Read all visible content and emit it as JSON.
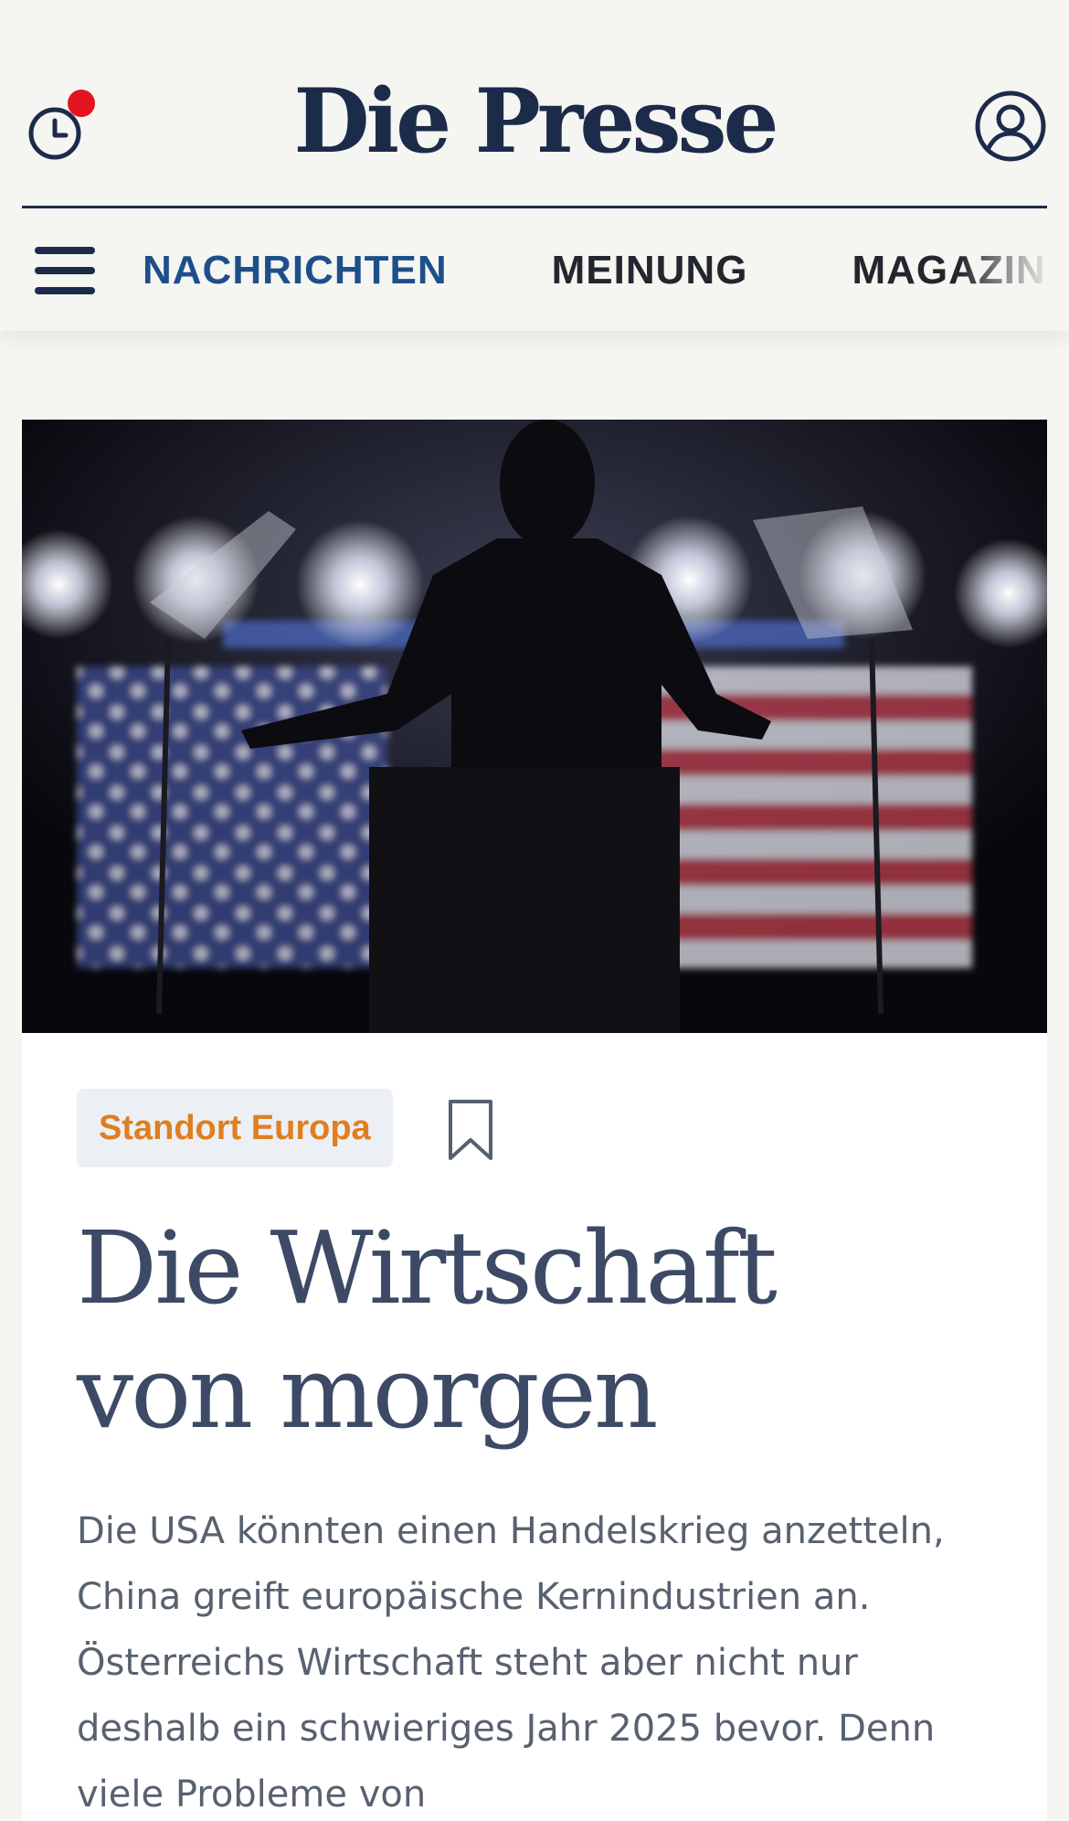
{
  "header": {
    "logo": "Die Presse",
    "has_notification": true
  },
  "nav": {
    "items": [
      {
        "label": "NACHRICHTEN",
        "active": true
      },
      {
        "label": "MEINUNG",
        "active": false
      },
      {
        "label": "MAGAZIN",
        "active": false
      }
    ]
  },
  "article": {
    "image_alt": "Silhouette eines Redners vor US-Flagge",
    "tag": "Standort Europa",
    "headline_line1": "Die Wirtschaft",
    "headline_line2": "von morgen",
    "teaser": "Die USA könnten einen Handelskrieg anzetteln, China greift europäische Kernindustrien an. Österreichs Wirtschaft steht aber nicht nur deshalb ein schwieriges Jahr 2025 bevor. Denn viele Probleme von"
  },
  "colors": {
    "brand_navy": "#1c2b4a",
    "nav_active": "#1d4f8a",
    "tag_text": "#e07e20",
    "notification": "#e3141e",
    "headline": "#3d4a66"
  },
  "icons": [
    "history-icon",
    "account-icon",
    "menu-icon",
    "bookmark-icon"
  ]
}
